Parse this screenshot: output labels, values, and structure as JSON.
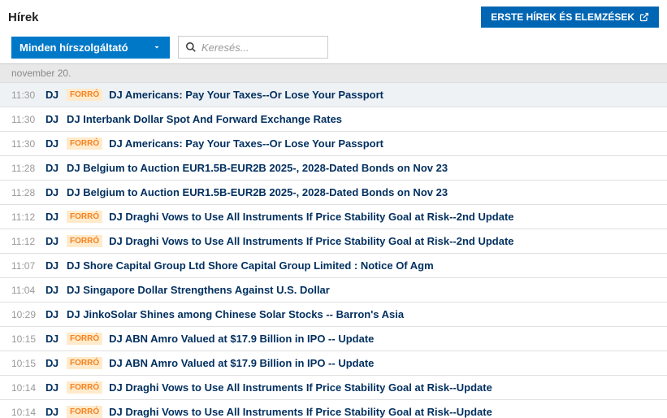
{
  "header": {
    "title": "Hírek",
    "erste_button": "ERSTE HÍREK ÉS ELEMZÉSEK"
  },
  "filter": {
    "dropdown_label": "Minden hírszolgáltató",
    "search_placeholder": "Keresés..."
  },
  "date_header": "november 20.",
  "hot_label": "FORRÓ",
  "source_label": "DJ",
  "news": [
    {
      "time": "11:30",
      "hot": true,
      "headline": "DJ Americans: Pay Your Taxes--Or Lose Your Passport",
      "selected": true
    },
    {
      "time": "11:30",
      "hot": false,
      "headline": "DJ Interbank Dollar Spot And Forward Exchange Rates"
    },
    {
      "time": "11:30",
      "hot": true,
      "headline": "DJ Americans: Pay Your Taxes--Or Lose Your Passport"
    },
    {
      "time": "11:28",
      "hot": false,
      "headline": "DJ Belgium to Auction EUR1.5B-EUR2B 2025-, 2028-Dated Bonds on Nov 23"
    },
    {
      "time": "11:28",
      "hot": false,
      "headline": "DJ Belgium to Auction EUR1.5B-EUR2B 2025-, 2028-Dated Bonds on Nov 23"
    },
    {
      "time": "11:12",
      "hot": true,
      "headline": "DJ Draghi Vows to Use All Instruments If Price Stability Goal at Risk--2nd Update"
    },
    {
      "time": "11:12",
      "hot": true,
      "headline": "DJ Draghi Vows to Use All Instruments If Price Stability Goal at Risk--2nd Update"
    },
    {
      "time": "11:07",
      "hot": false,
      "headline": "DJ Shore Capital Group Ltd Shore Capital Group Limited : Notice Of Agm"
    },
    {
      "time": "11:04",
      "hot": false,
      "headline": "DJ Singapore Dollar Strengthens Against U.S. Dollar"
    },
    {
      "time": "10:29",
      "hot": false,
      "headline": "DJ JinkoSolar Shines among Chinese Solar Stocks -- Barron's Asia"
    },
    {
      "time": "10:15",
      "hot": true,
      "headline": "DJ ABN Amro Valued at $17.9 Billion in IPO -- Update"
    },
    {
      "time": "10:15",
      "hot": true,
      "headline": "DJ ABN Amro Valued at $17.9 Billion in IPO -- Update"
    },
    {
      "time": "10:14",
      "hot": true,
      "headline": "DJ Draghi Vows to Use All Instruments If Price Stability Goal at Risk--Update"
    },
    {
      "time": "10:14",
      "hot": true,
      "headline": "DJ Draghi Vows to Use All Instruments If Price Stability Goal at Risk--Update"
    }
  ]
}
